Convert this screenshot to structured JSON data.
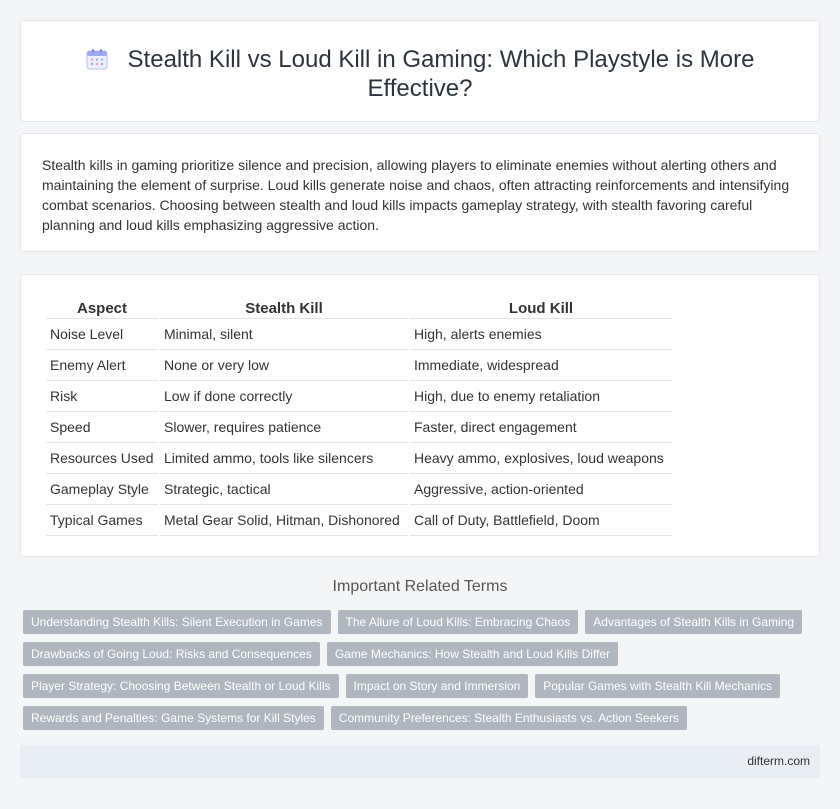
{
  "header": {
    "icon": "calendar-icon",
    "title": "Stealth Kill vs Loud Kill in Gaming: Which Playstyle is More Effective?"
  },
  "intro": {
    "text": "Stealth kills in gaming prioritize silence and precision, allowing players to eliminate enemies without alerting others and maintaining the element of surprise. Loud kills generate noise and chaos, often attracting reinforcements and intensifying combat scenarios. Choosing between stealth and loud kills impacts gameplay strategy, with stealth favoring careful planning and loud kills emphasizing aggressive action."
  },
  "comparison": {
    "headers": [
      "Aspect",
      "Stealth Kill",
      "Loud Kill"
    ],
    "rows": [
      [
        "Noise Level",
        "Minimal, silent",
        "High, alerts enemies"
      ],
      [
        "Enemy Alert",
        "None or very low",
        "Immediate, widespread"
      ],
      [
        "Risk",
        "Low if done correctly",
        "High, due to enemy retaliation"
      ],
      [
        "Speed",
        "Slower, requires patience",
        "Faster, direct engagement"
      ],
      [
        "Resources Used",
        "Limited ammo, tools like silencers",
        "Heavy ammo, explosives, loud weapons"
      ],
      [
        "Gameplay Style",
        "Strategic, tactical",
        "Aggressive, action-oriented"
      ],
      [
        "Typical Games",
        "Metal Gear Solid, Hitman, Dishonored",
        "Call of Duty, Battlefield, Doom"
      ]
    ]
  },
  "related": {
    "heading": "Important Related Terms",
    "tags": [
      "Understanding Stealth Kills: Silent Execution in Games",
      "The Allure of Loud Kills: Embracing Chaos",
      "Advantages of Stealth Kills in Gaming",
      "Drawbacks of Going Loud: Risks and Consequences",
      "Game Mechanics: How Stealth and Loud Kills Differ",
      "Player Strategy: Choosing Between Stealth or Loud Kills",
      "Impact on Story and Immersion",
      "Popular Games with Stealth Kill Mechanics",
      "Rewards and Penalties: Game Systems for Kill Styles",
      "Community Preferences: Stealth Enthusiasts vs. Action Seekers"
    ]
  },
  "footer": {
    "site": "difterm.com"
  },
  "colors": {
    "tag_bg": "#b0b6c0",
    "footer_bg": "#e9eef5",
    "icon_accent": "#8f9be6"
  }
}
